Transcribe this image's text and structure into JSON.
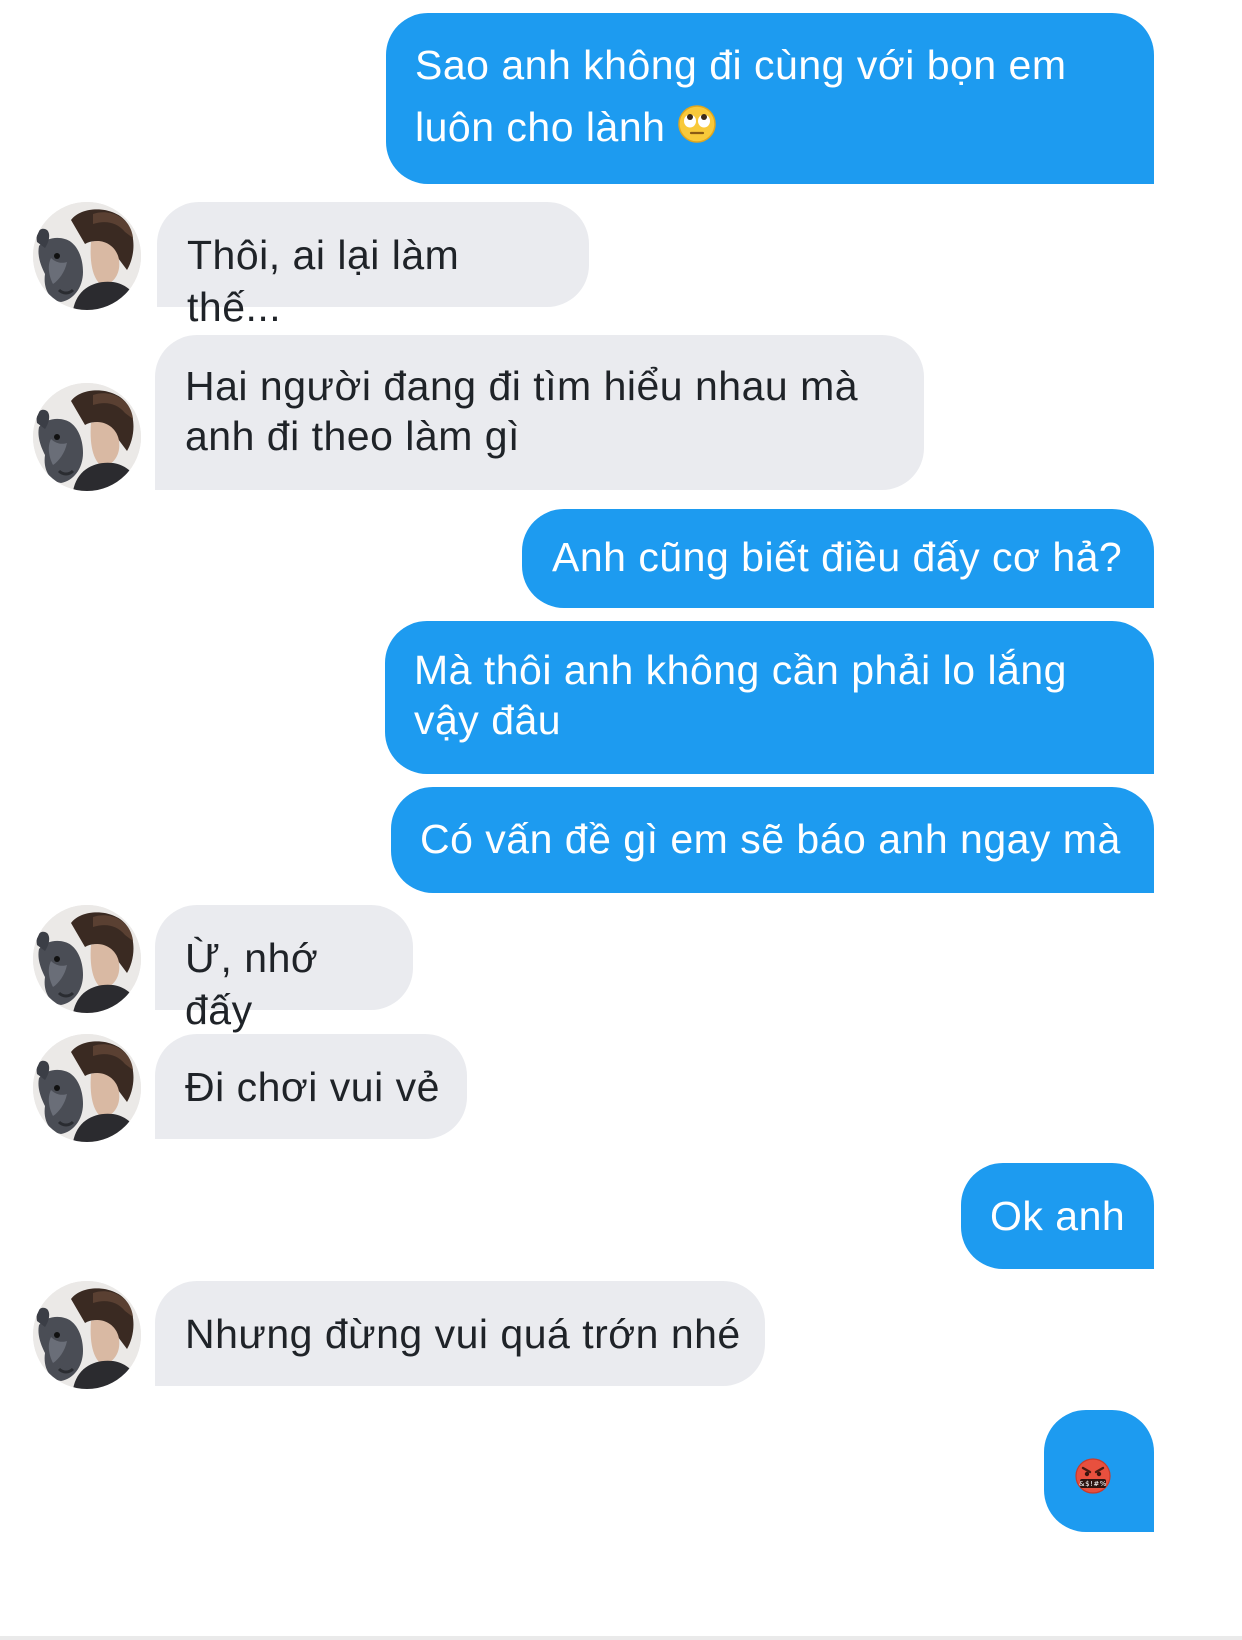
{
  "conversation": {
    "messages": [
      {
        "from": "me",
        "text": "Sao anh không đi cùng với bọn em",
        "text2": "luôn cho lành",
        "emoji": "face-with-rolling-eyes"
      },
      {
        "from": "them",
        "text": "Thôi, ai lại làm thế..."
      },
      {
        "from": "them",
        "text": "Hai người đang đi tìm hiểu nhau mà",
        "text2": "anh đi theo làm gì"
      },
      {
        "from": "me",
        "text": "Anh cũng biết điều đấy cơ hả?"
      },
      {
        "from": "me",
        "text": "Mà thôi anh không cần phải lo lắng",
        "text2": "vậy đâu"
      },
      {
        "from": "me",
        "text": "Có vấn đề gì em sẽ báo anh ngay mà"
      },
      {
        "from": "them",
        "text": "Ừ, nhớ đấy"
      },
      {
        "from": "them",
        "text": "Đi chơi vui vẻ"
      },
      {
        "from": "me",
        "text": "Ok anh"
      },
      {
        "from": "them",
        "text": "Nhưng đừng vui quá trớn nhé"
      },
      {
        "from": "me",
        "emoji": "face-with-symbols-on-mouth"
      }
    ]
  },
  "colors": {
    "outgoing_bubble": "#1d9bf0",
    "incoming_bubble": "#eaebef",
    "outgoing_text": "#ffffff",
    "incoming_text": "#1f2328"
  },
  "icons": {
    "avatar": "contact-avatar",
    "rolling_eyes": "face-with-rolling-eyes-emoji",
    "cursing": "face-with-symbols-on-mouth-emoji"
  }
}
